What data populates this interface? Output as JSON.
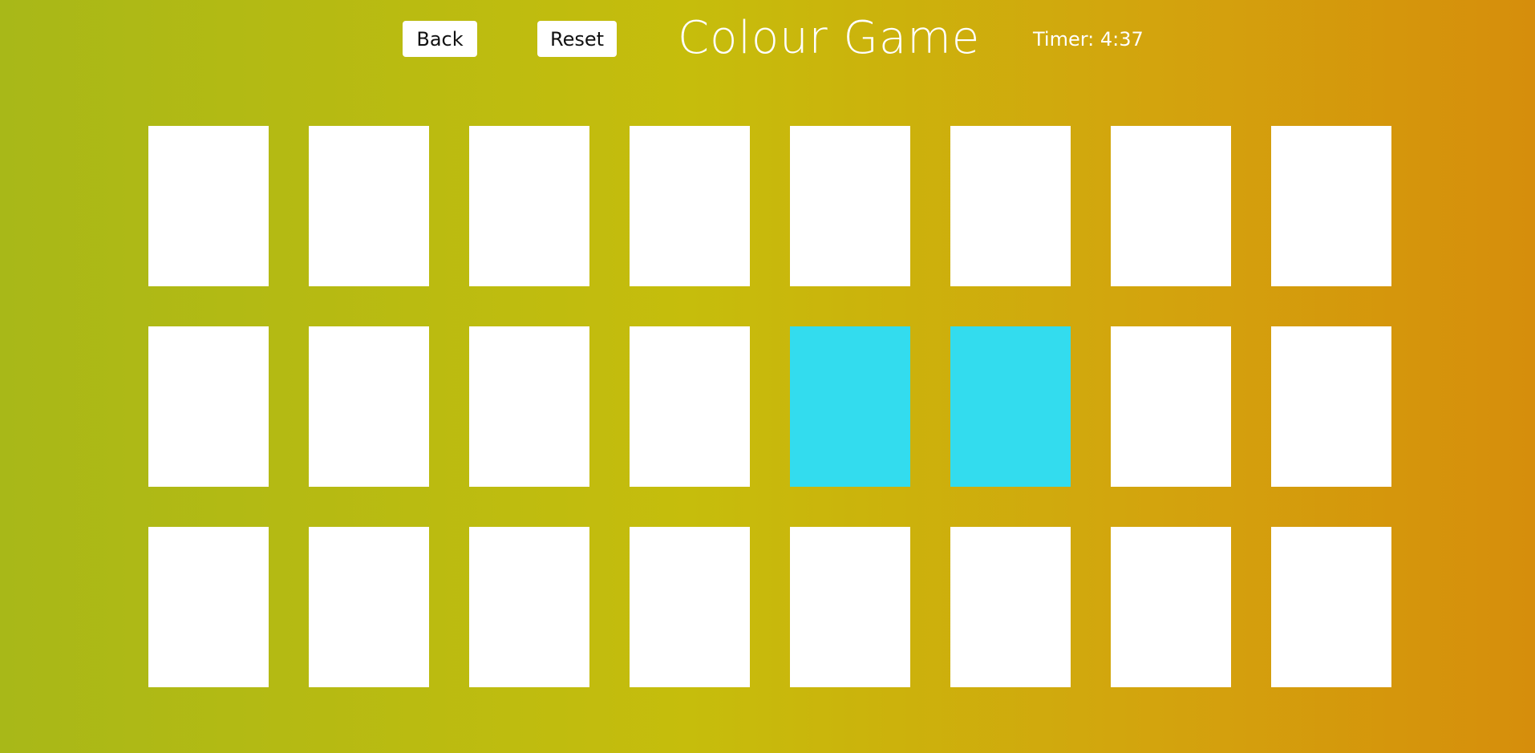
{
  "header": {
    "back_label": "Back",
    "reset_label": "Reset",
    "title": "Colour Game",
    "timer_text": "Timer: 4:37"
  },
  "colors": {
    "card_face_down": "#ffffff",
    "card_revealed": "#33dcee",
    "text": "#ffffff"
  },
  "grid": {
    "rows": 3,
    "columns": 8,
    "revealed_cards": [
      {
        "row": 2,
        "column": 5,
        "color": "#33dcee"
      },
      {
        "row": 2,
        "column": 6,
        "color": "#33dcee"
      }
    ]
  }
}
